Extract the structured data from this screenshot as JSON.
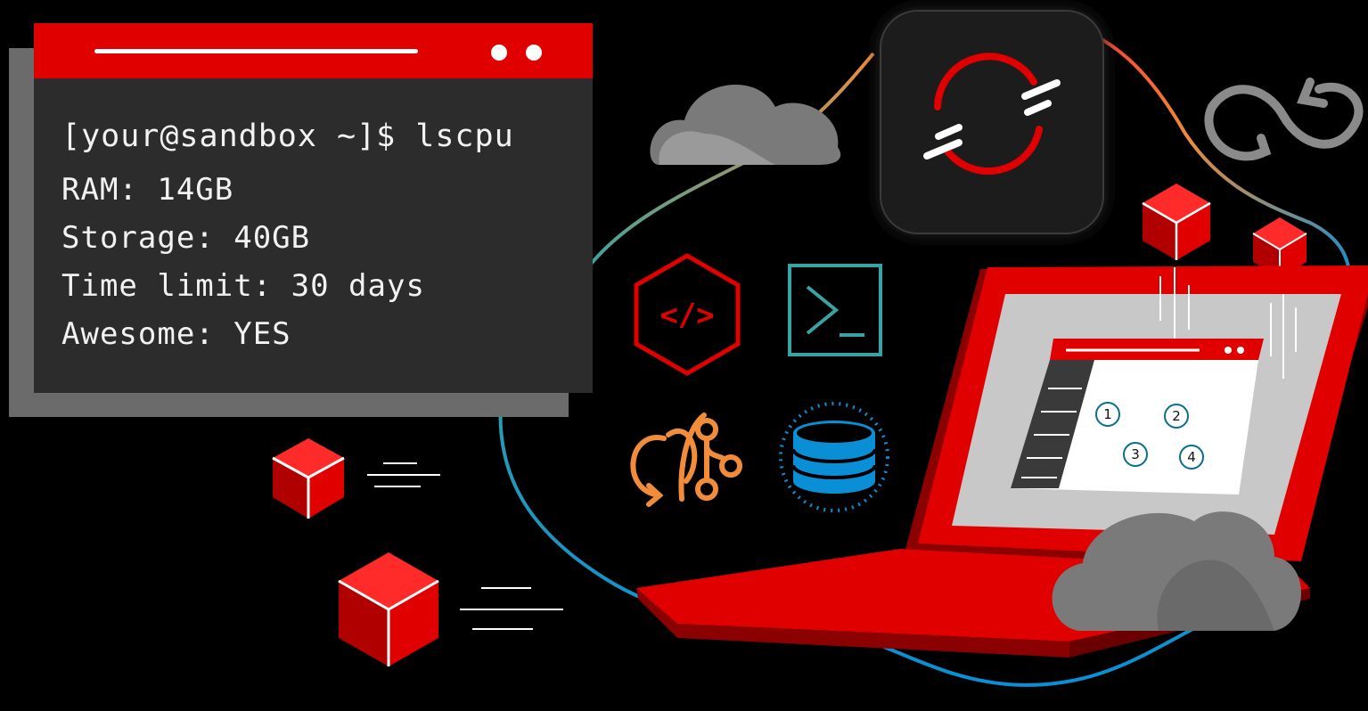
{
  "colors": {
    "background": "#000000",
    "terminal_body": "#2c2c2c",
    "terminal_shadow": "#6b6b6b",
    "brand_red": "#e00000",
    "dark_red": "#8b0000",
    "cloud_gray": "#7a7a7a",
    "teal": "#37a3a3",
    "orange": "#f08c3a",
    "blue": "#0a8fd6"
  },
  "terminal": {
    "prompt": "[your@sandbox ~]$ lscpu",
    "lines": {
      "ram": "RAM: 14GB",
      "storage": "Storage: 40GB",
      "time_limit": "Time limit: 30 days",
      "awesome": "Awesome: YES"
    }
  },
  "icons": {
    "code": "code-hexagon-icon",
    "terminal": "terminal-prompt-icon",
    "pipeline": "git-pipeline-icon",
    "database": "database-icon",
    "openshift": "openshift-logo-icon",
    "infinity": "infinity-loop-icon",
    "cloud": "cloud-icon",
    "cube": "cube-icon",
    "laptop": "laptop-icon"
  },
  "laptop_screen": {
    "steps": [
      "1",
      "2",
      "3",
      "4"
    ]
  }
}
